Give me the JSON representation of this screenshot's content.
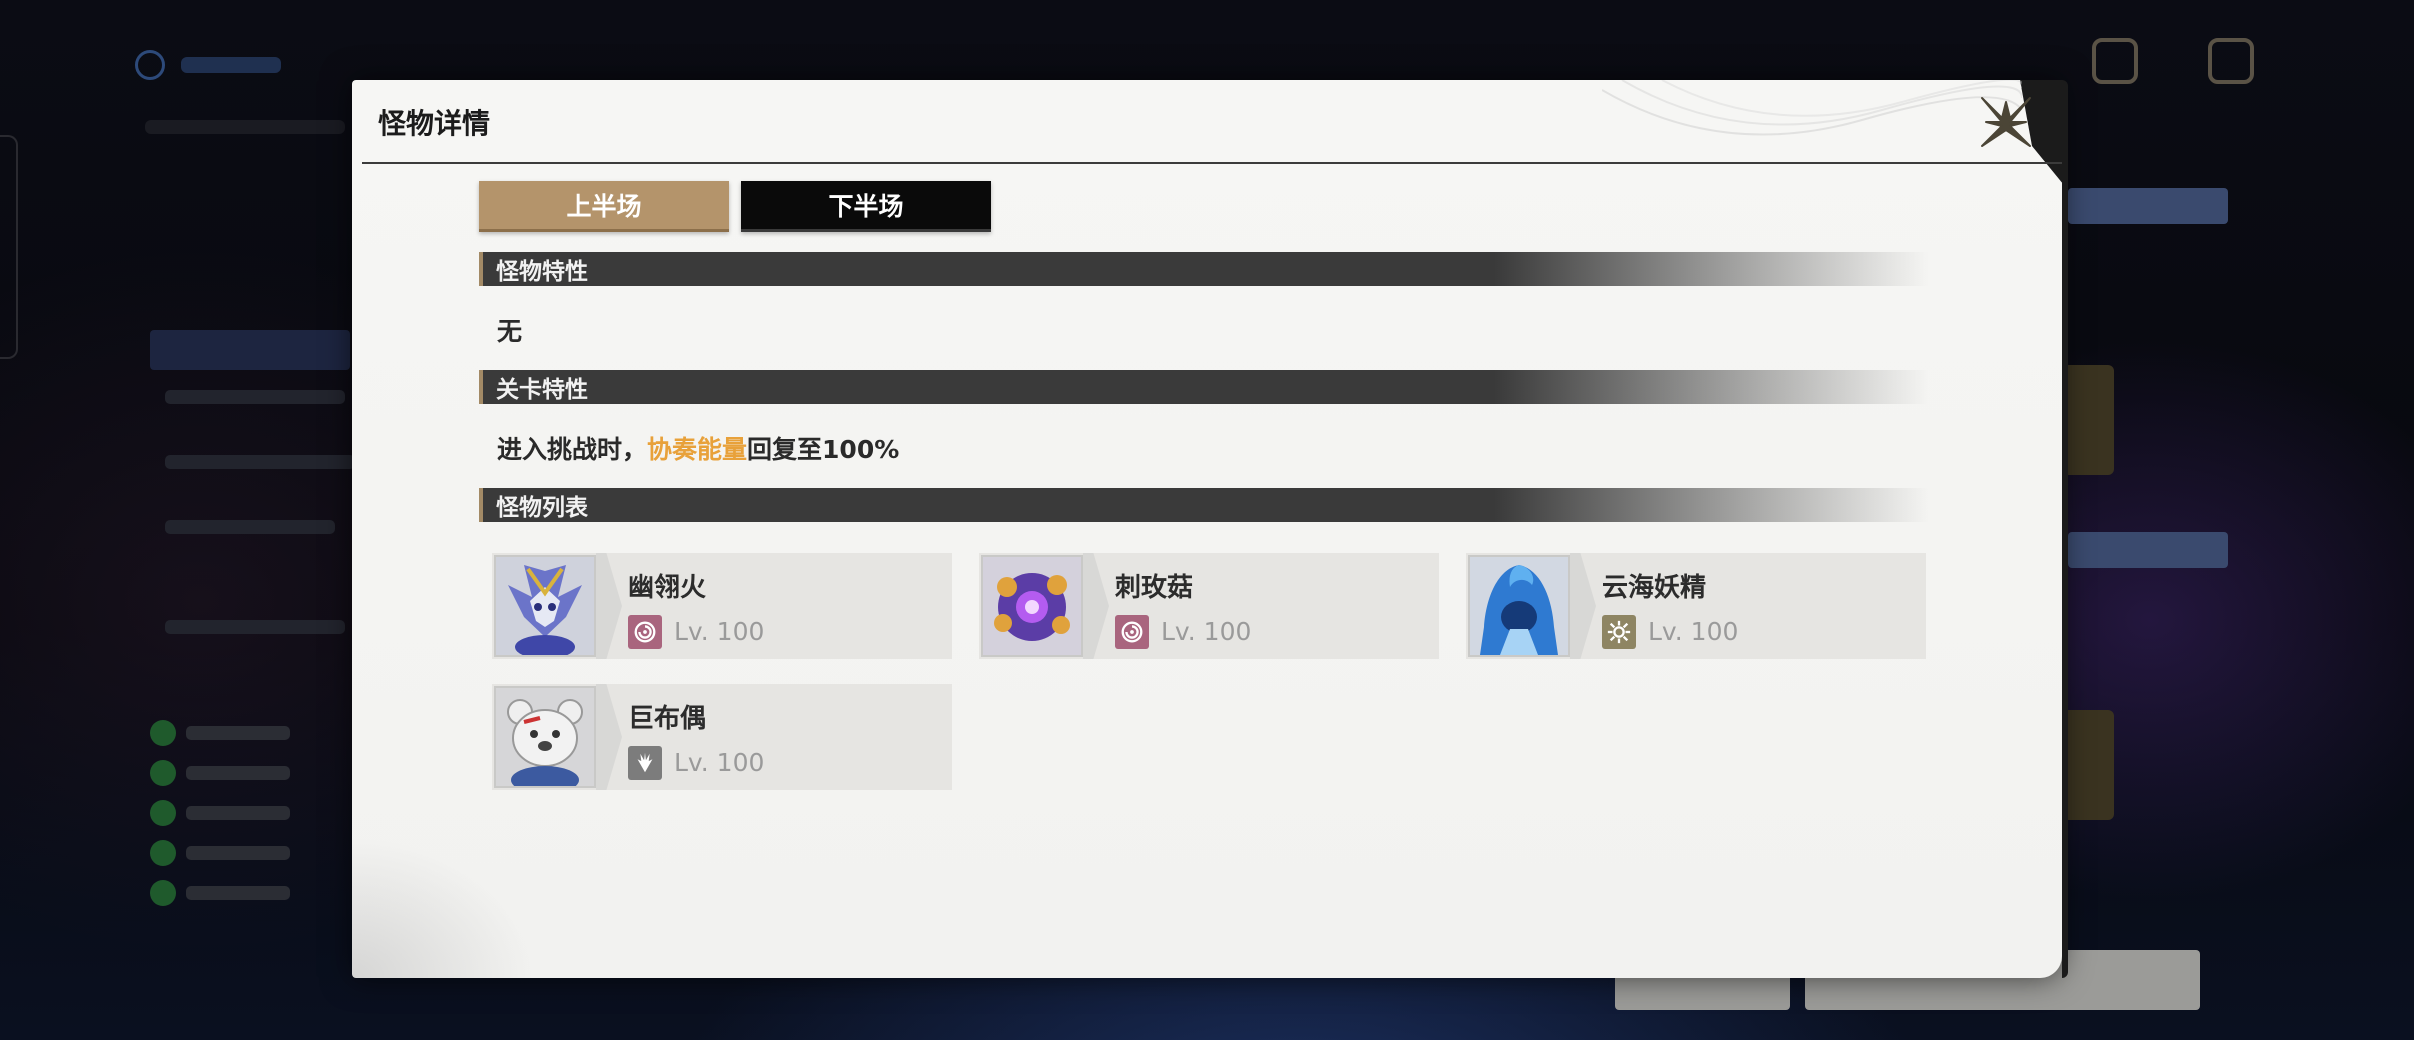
{
  "modal": {
    "title": "怪物详情",
    "tabs": [
      {
        "label": "上半场",
        "selected": true
      },
      {
        "label": "下半场",
        "selected": false
      }
    ],
    "sections": [
      {
        "title": "怪物特性",
        "text": "无"
      },
      {
        "title": "关卡特性",
        "text_parts": [
          "进入挑战时，",
          "协奏能量",
          "回复至100%"
        ]
      },
      {
        "title": "怪物列表"
      }
    ],
    "monsters": [
      {
        "name": "幽翎火",
        "level": "Lv. 100",
        "attribute_icon": "aero-swirl-icon",
        "attribute_color": "#a9657e"
      },
      {
        "name": "刺玫菇",
        "level": "Lv. 100",
        "attribute_icon": "aero-swirl-icon",
        "attribute_color": "#a9657e"
      },
      {
        "name": "云海妖精",
        "level": "Lv. 100",
        "attribute_icon": "spectro-sun-icon",
        "attribute_color": "#8e8563"
      },
      {
        "name": "巨布偶",
        "level": "Lv. 100",
        "attribute_icon": "havoc-claw-icon",
        "attribute_color": "#7c7c7c"
      }
    ]
  },
  "colors": {
    "tab_active": "#b4946b",
    "tab_inactive": "#0a0a0a",
    "section_bar": "#3a3a3a",
    "highlight": "#e8a13a"
  }
}
